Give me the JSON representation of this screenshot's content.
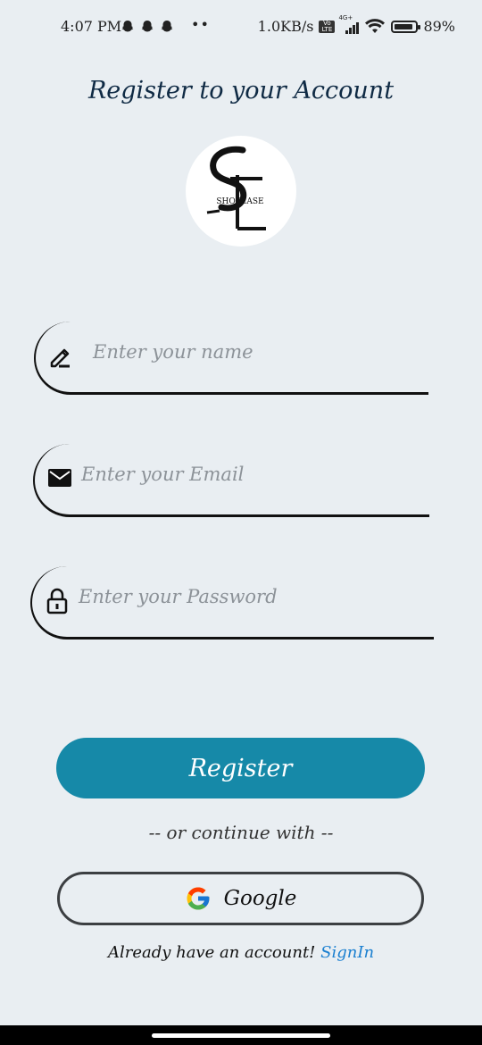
{
  "status_bar": {
    "time": "4:07 PM",
    "dots": "••",
    "speed": "1.0KB/s",
    "network": "4G+",
    "battery_text": "89%",
    "battery_level": 0.89
  },
  "page": {
    "title": "Register to your Account"
  },
  "logo": {
    "text": "SHOPEASE"
  },
  "fields": {
    "name_placeholder": "Enter your name",
    "email_placeholder": "Enter your Email",
    "password_placeholder": "Enter your Password"
  },
  "actions": {
    "register_label": "Register",
    "or_text": "-- or continue with --",
    "google_label": "Google",
    "already_text": "Already have an account!",
    "signin_label": "SignIn"
  },
  "colors": {
    "primary": "#1689a8",
    "background": "#e9eef2",
    "link": "#1a7fd0",
    "title": "#0f2a44"
  }
}
